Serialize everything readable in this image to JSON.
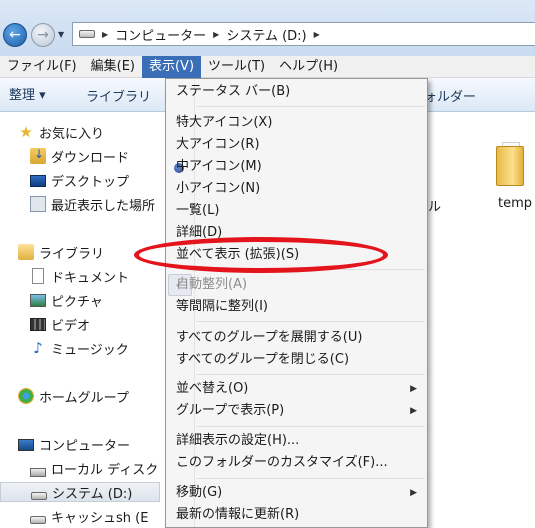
{
  "address": {
    "crumbs": [
      "コンピューター",
      "システム (D:)"
    ]
  },
  "menubar": {
    "items": [
      "ファイル(F)",
      "編集(E)",
      "表示(V)",
      "ツール(T)",
      "ヘルプ(H)"
    ]
  },
  "toolbar": {
    "organize": "整理 ▾",
    "library": "ライブラリ",
    "folder": "ォルダー"
  },
  "navpane": {
    "favorites": "お気に入り",
    "downloads": "ダウンロード",
    "desktop": "デスクトップ",
    "recent": "最近表示した場所",
    "libraries": "ライブラリ",
    "documents": "ドキュメント",
    "pictures": "ピクチャ",
    "videos": "ビデオ",
    "music": "ミュージック",
    "homegroup": "ホームグループ",
    "computer": "コンピューター",
    "local_disk": "ローカル ディスク",
    "system_drive": "システム (D:)",
    "cache_drive": "キャッシュsh (E"
  },
  "content": {
    "temp_label": "temp",
    "hidden_fragment": "ル"
  },
  "view_menu": {
    "status_bar": "ステータス バー(B)",
    "extra_large_icons": "特大アイコン(X)",
    "large_icons": "大アイコン(R)",
    "medium_icons": "中アイコン(M)",
    "small_icons": "小アイコン(N)",
    "list": "一覧(L)",
    "details": "詳細(D)",
    "tiles_extended": "並べて表示 (拡張)(S)",
    "auto_arrange": "自動整列(A)",
    "align_to_grid": "等間隔に整列(I)",
    "expand_groups": "すべてのグループを展開する(U)",
    "collapse_groups": "すべてのグループを閉じる(C)",
    "sort_by": "並べ替え(O)",
    "group_by": "グループで表示(P)",
    "choose_details": "詳細表示の設定(H)...",
    "customize_folder": "このフォルダーのカスタマイズ(F)...",
    "go_to": "移動(G)",
    "refresh": "最新の情報に更新(R)"
  },
  "state": {
    "selected_view": "medium_icons",
    "auto_arrange_checked": true,
    "highlight_color": "#e3141b",
    "active_menu_color": "#3a6fb8"
  }
}
